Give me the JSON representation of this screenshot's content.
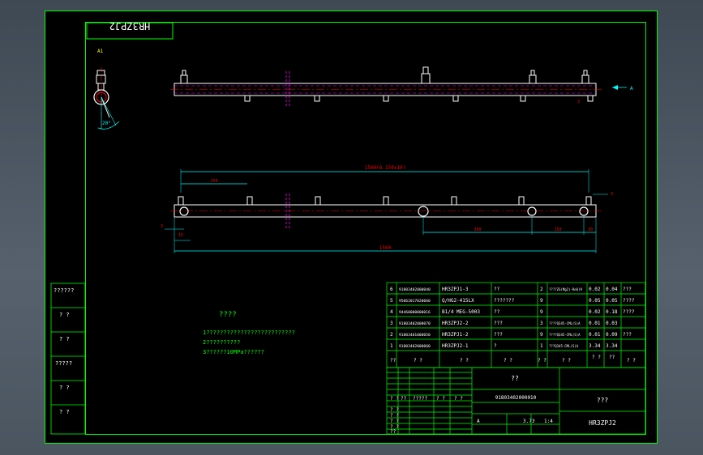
{
  "drawing": {
    "title_block_mirrored": "HR3ZPJ2",
    "view_label": "A1",
    "view_arrow_label": "A",
    "angle_label": "20°",
    "dims": {
      "total_span": "1500(6.150x10)",
      "pitch_first": "150",
      "overall": "1560",
      "seg_300": "300",
      "seg_150": "150",
      "end_30": "30",
      "left_3": "3",
      "left_15": "15",
      "right_3": "3",
      "top_right_3": "3"
    }
  },
  "notes": {
    "title": "????",
    "lines": [
      "1??????????????????????????",
      "2??????????",
      "3??????10MPa??????"
    ]
  },
  "left_strip": [
    "??????",
    "? ?",
    "? ?",
    "?????",
    "? ?",
    "? ?"
  ],
  "bom": {
    "rows": [
      {
        "no": "6",
        "code": "91803402000040",
        "name": "HR3ZPJ1-3",
        "qty_cn": "??",
        "qty": "2",
        "material": "????ZG(Mg2)-Re6)9",
        "w1": "0.02",
        "w2": "0.04",
        "note": "???"
      },
      {
        "no": "5",
        "code": "95062017020060",
        "name": "Q/HG2-415LX",
        "qty_cn": "???????",
        "qty": "9",
        "material": "",
        "w1": "0.05",
        "w2": "0.05",
        "note": "????"
      },
      {
        "no": "4",
        "code": "94460000000016",
        "name": "B1/4 MEG-5003",
        "qty_cn": "??",
        "qty": "9",
        "material": "",
        "w1": "0.02",
        "w2": "0.18",
        "note": "????"
      },
      {
        "no": "3",
        "code": "91803402000070",
        "name": "HR3ZPJ2-2",
        "qty_cn": "???",
        "qty": "3",
        "material": "????Q345-CML(S)A",
        "w1": "0.01",
        "w2": "0.03",
        "note": ""
      },
      {
        "no": "2",
        "code": "91803401000050",
        "name": "HR3ZPJ1-2",
        "qty_cn": "???",
        "qty": "9",
        "material": "????Q345-CML(S)A",
        "w1": "0.01",
        "w2": "0.09",
        "note": "???"
      },
      {
        "no": "1",
        "code": "91803402000060",
        "name": "HR3ZPJ2-1",
        "qty_cn": "?",
        "qty": "1",
        "material": "???Q345-CML(S)A",
        "w1": "3.34",
        "w2": "3.34",
        "note": ""
      }
    ],
    "header": [
      "??",
      "? ?",
      "? ?",
      "? ?",
      "? ?",
      "? ?",
      "? ?",
      "??",
      "? ?"
    ]
  },
  "title_block": {
    "part_label": "??",
    "code": "91803402000010",
    "name": "???",
    "drawing_no": "HR3ZPJ2",
    "stage": "A",
    "weight": "3.73",
    "scale": "1:4",
    "row_labels": [
      "? ?",
      "? ?",
      "? ?",
      "? ?",
      "??"
    ],
    "col_labels": [
      "? ?",
      "??",
      "?????",
      "? ?",
      "? ?"
    ]
  },
  "colors": {
    "border": "#00ff00",
    "line": "#ffffff",
    "dim": "#00ffff",
    "centerline": "#ff0000",
    "hidden": "#ff00ff",
    "part": "#ffff80"
  }
}
